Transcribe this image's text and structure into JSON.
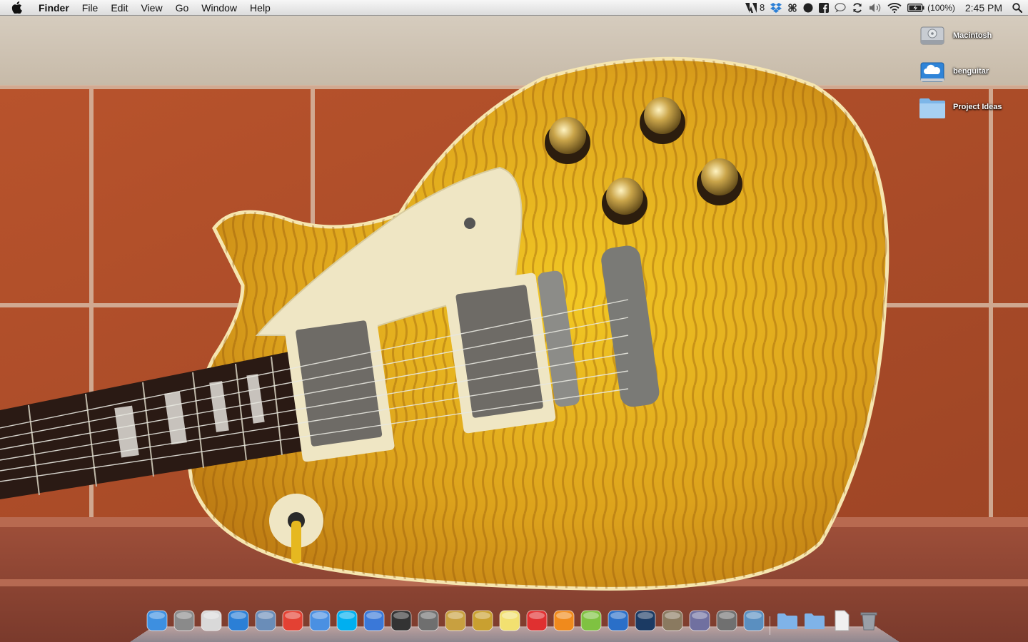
{
  "menubar": {
    "app_name": "Finder",
    "menus": [
      "File",
      "Edit",
      "View",
      "Go",
      "Window",
      "Help"
    ],
    "status": {
      "adobe_count": "8",
      "battery": "(100%)",
      "clock": "2:45 PM"
    }
  },
  "desktop": {
    "icons": [
      {
        "label": "Macintosh",
        "icon": "hard-drive-icon"
      },
      {
        "label": "benguitar",
        "icon": "icloud-drive-icon"
      },
      {
        "label": "Project Ideas",
        "icon": "folder-icon"
      }
    ]
  },
  "dock": {
    "apps": [
      {
        "name": "finder",
        "color": "#3d8fe0"
      },
      {
        "name": "system-preferences",
        "color": "#8a8a8a"
      },
      {
        "name": "preview",
        "color": "#d9d9d9"
      },
      {
        "name": "safari",
        "color": "#2b7fd6"
      },
      {
        "name": "mail",
        "color": "#6a8db8"
      },
      {
        "name": "chrome",
        "color": "#e34133"
      },
      {
        "name": "ichat",
        "color": "#4a90e2"
      },
      {
        "name": "skype",
        "color": "#00aff0"
      },
      {
        "name": "itunes",
        "color": "#3a78d8"
      },
      {
        "name": "piano",
        "color": "#333333"
      },
      {
        "name": "quicktime",
        "color": "#6f6f6f"
      },
      {
        "name": "aperture",
        "color": "#c8a040"
      },
      {
        "name": "logic",
        "color": "#c9a030"
      },
      {
        "name": "stickies",
        "color": "#f2e070"
      },
      {
        "name": "keyboard-maestro",
        "color": "#e03030"
      },
      {
        "name": "vlc",
        "color": "#f08a1c"
      },
      {
        "name": "utorrent",
        "color": "#7fc241"
      },
      {
        "name": "garageband",
        "color": "#2a6fc8"
      },
      {
        "name": "photoshop",
        "color": "#1b3a63"
      },
      {
        "name": "gimp",
        "color": "#8a7a60"
      },
      {
        "name": "script-editor",
        "color": "#7070a0"
      },
      {
        "name": "imovie",
        "color": "#707070"
      },
      {
        "name": "facetime",
        "color": "#5a8fc0"
      }
    ],
    "stacks": [
      {
        "name": "documents-stack",
        "color": "#7fb3e8"
      },
      {
        "name": "downloads-stack",
        "color": "#7fb3e8"
      },
      {
        "name": "file-stack",
        "color": "#f0f0f0"
      },
      {
        "name": "trash",
        "color": "#9aa0a8"
      }
    ]
  }
}
